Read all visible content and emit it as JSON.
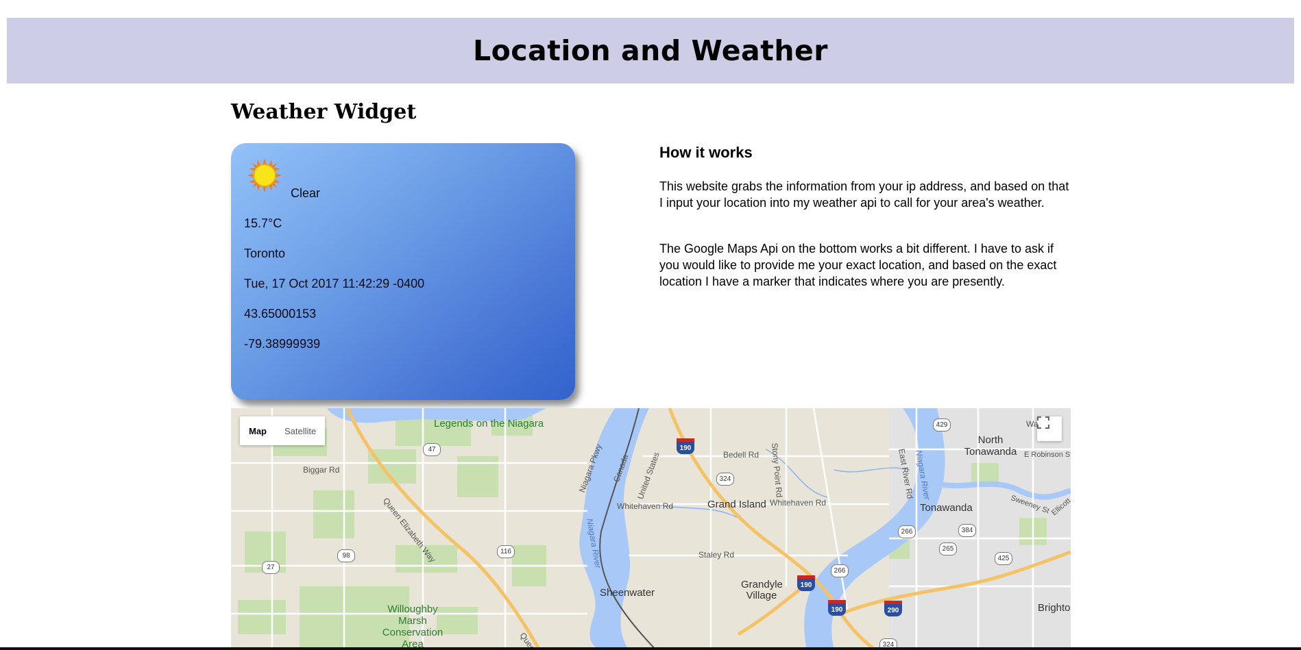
{
  "header": {
    "title": "Location and Weather"
  },
  "widget": {
    "section_title": "Weather Widget",
    "icon": "sun-icon",
    "condition": "Clear",
    "temperature": "15.7°C",
    "city": "Toronto",
    "datetime": "Tue, 17 Oct 2017 11:42:29 -0400",
    "latitude": "43.65000153",
    "longitude": "-79.38999939"
  },
  "how": {
    "title": "How it works",
    "p1": "This website grabs the information from your ip address, and based on that I input your location into my weather api to call for your area's weather.",
    "p2": "The Google Maps Api on the bottom works a bit different. I have to ask if you would like to provide me your exact location, and based on the exact location I have a marker that indicates where you are presently."
  },
  "map": {
    "type_map": "Map",
    "type_satellite": "Satellite",
    "colors": {
      "water": "#a8c8f8",
      "land": "#e8e4d8",
      "park": "#c8dfb0",
      "highway": "#f5c266",
      "urban": "#e2e2e2"
    },
    "labels": {
      "legends": "Legends on the Niagara",
      "biggar": "Biggar Rd",
      "qew": "Queen Elizabeth Way",
      "niagara_pkwy": "Niagara Pkwy",
      "canada": "Canada",
      "united_states": "United States",
      "niagara_river": "Niagara River",
      "whitehaven_w": "Whitehaven Rd",
      "grand_island": "Grand Island",
      "whitehaven_e": "Whitehaven Rd",
      "bedell": "Bedell Rd",
      "stony_point": "Stony Point Rd",
      "staley": "Staley Rd",
      "grandyle": "Grandyle Village",
      "sheenwater": "Sheenwater",
      "willoughby": "Willoughby Marsh Conservation Area",
      "queen": "Queen",
      "east_river": "East River Rd",
      "niagara_river_e": "Niagara River",
      "north_tonawanda": "North Tonawanda",
      "e_robinson": "E Robinson St",
      "tonawanda": "Tonawanda",
      "sweeney": "Sweeney St",
      "ellicott": "Ellicott Cr",
      "brighton": "Brighto",
      "wa": "Wa"
    },
    "shields": {
      "r47": "47",
      "r27": "27",
      "r98": "98",
      "r116": "116",
      "r324a": "324",
      "r429": "429",
      "r266a": "266",
      "r384": "384",
      "r265": "265",
      "r425": "425",
      "r266b": "266",
      "r324b": "324"
    },
    "interstates": {
      "i190a": "190",
      "i190b": "190",
      "i190c": "190",
      "i290": "290"
    }
  }
}
